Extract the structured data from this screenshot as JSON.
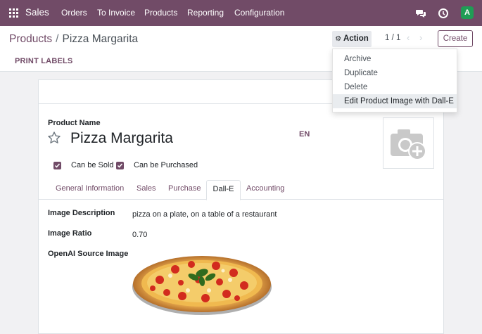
{
  "navbar": {
    "app_name": "Sales",
    "menu": [
      "Orders",
      "To Invoice",
      "Products",
      "Reporting",
      "Configuration"
    ],
    "avatar_letter": "A",
    "avatar_color": "#1f9d55",
    "brand_color": "#714b67"
  },
  "breadcrumb": {
    "parent": "Products",
    "separator": "/",
    "current": "Pizza Margarita"
  },
  "toolbar": {
    "action_label": "Action",
    "pager": "1 / 1",
    "create_label": "Create",
    "print_labels": "PRINT LABELS"
  },
  "action_menu": {
    "items": [
      "Archive",
      "Duplicate",
      "Delete",
      "Edit Product Image with Dall-E"
    ],
    "active_item": "Edit Product Image with Dall-E"
  },
  "product": {
    "name_label": "Product Name",
    "name": "Pizza Margarita",
    "lang": "EN",
    "can_be_sold_label": "Can be Sold",
    "can_be_sold": true,
    "can_be_purchased_label": "Can be Purchased",
    "can_be_purchased": true
  },
  "tabs": {
    "items": [
      "General Information",
      "Sales",
      "Purchase",
      "Dall-E",
      "Accounting"
    ],
    "active": "Dall-E"
  },
  "dalle": {
    "description_label": "Image Description",
    "description": "pizza on a plate, on a table of a restaurant",
    "ratio_label": "Image Ratio",
    "ratio": "0.70",
    "source_label": "OpenAI Source Image"
  }
}
